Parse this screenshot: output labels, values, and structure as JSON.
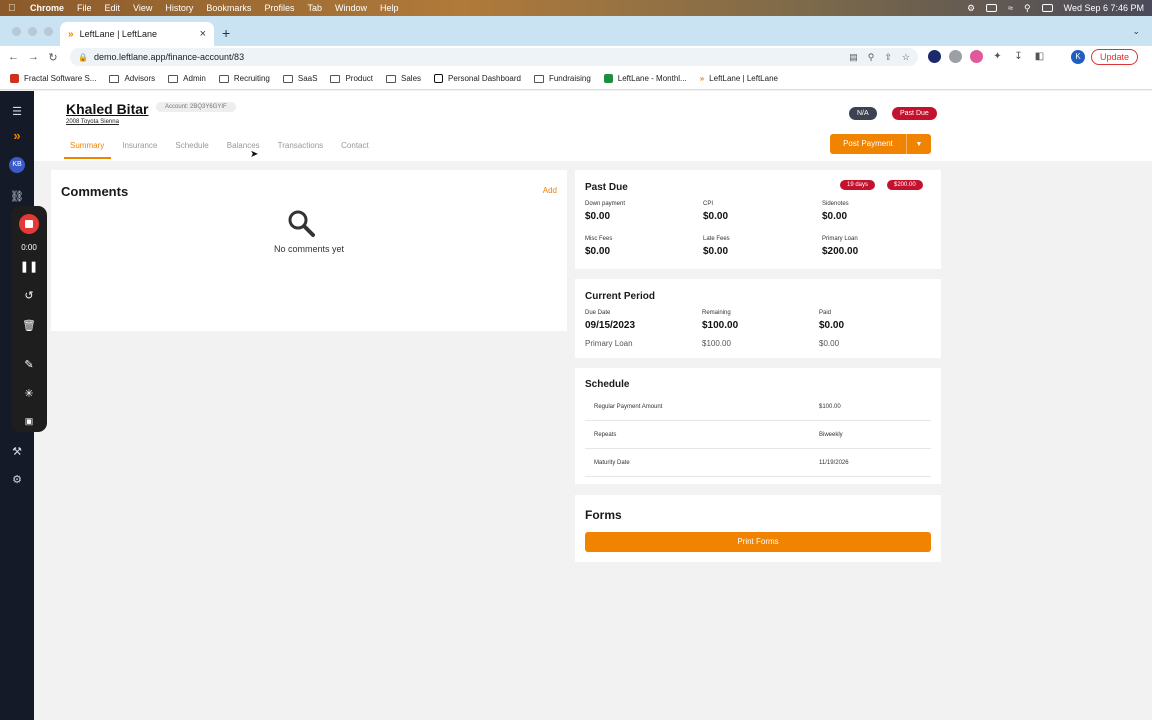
{
  "os_menubar": {
    "app_name": "Chrome",
    "menus": [
      "File",
      "Edit",
      "View",
      "History",
      "Bookmarks",
      "Profiles",
      "Tab",
      "Window",
      "Help"
    ],
    "clock": "Wed Sep 6  7:46 PM"
  },
  "browser": {
    "tab_title": "LeftLane | LeftLane",
    "url": "demo.leftlane.app/finance-account/83",
    "update_label": "Update",
    "profile_initial": "K",
    "bookmarks": [
      {
        "label": "Fractal Software S...",
        "icon": "fractal-icon"
      },
      {
        "label": "Advisors",
        "icon": "folder-icon"
      },
      {
        "label": "Admin",
        "icon": "folder-icon"
      },
      {
        "label": "Recruiting",
        "icon": "folder-icon"
      },
      {
        "label": "SaaS",
        "icon": "folder-icon"
      },
      {
        "label": "Product",
        "icon": "folder-icon"
      },
      {
        "label": "Sales",
        "icon": "folder-icon"
      },
      {
        "label": "Personal Dashboard",
        "icon": "notion-icon"
      },
      {
        "label": "Fundraising",
        "icon": "folder-icon"
      },
      {
        "label": "LeftLane - Monthl...",
        "icon": "sheets-icon"
      },
      {
        "label": "LeftLane | LeftLane",
        "icon": "leftlane-icon"
      }
    ]
  },
  "leftnav": {
    "user_initials": "KB"
  },
  "recorder": {
    "time": "0:00"
  },
  "account": {
    "name": "Khaled Bitar",
    "account_label": "Account: 2BQ3Y6GYIF",
    "vehicle": "2008 Toyota Sienna",
    "status_na": "N/A",
    "status_past_due": "Past Due",
    "post_payment_label": "Post Payment",
    "tabs": [
      "Summary",
      "Insurance",
      "Schedule",
      "Balances",
      "Transactions",
      "Contact"
    ],
    "active_tab": "Summary"
  },
  "comments": {
    "title": "Comments",
    "add_label": "Add",
    "empty_text": "No comments yet"
  },
  "past_due": {
    "title": "Past Due",
    "days_chip": "19 days",
    "amount_chip": "$200.00",
    "items": [
      {
        "label": "Down payment",
        "value": "$0.00"
      },
      {
        "label": "CPI",
        "value": "$0.00"
      },
      {
        "label": "Sidenotes",
        "value": "$0.00"
      },
      {
        "label": "Misc Fees",
        "value": "$0.00"
      },
      {
        "label": "Late Fees",
        "value": "$0.00"
      },
      {
        "label": "Primary Loan",
        "value": "$200.00"
      }
    ]
  },
  "current_period": {
    "title": "Current Period",
    "due_date_label": "Due Date",
    "due_date": "09/15/2023",
    "remaining_label": "Remaining",
    "remaining": "$100.00",
    "paid_label": "Paid",
    "paid": "$0.00",
    "line_label": "Primary Loan",
    "line_remaining": "$100.00",
    "line_paid": "$0.00"
  },
  "schedule": {
    "title": "Schedule",
    "rows": [
      {
        "key": "Regular Payment Amount",
        "value": "$100.00"
      },
      {
        "key": "Repeats",
        "value": "Biweekly"
      },
      {
        "key": "Maturity Date",
        "value": "11/19/2026"
      }
    ]
  },
  "forms": {
    "title": "Forms",
    "print_label": "Print Forms"
  },
  "colors": {
    "accent": "#f08300",
    "danger": "#c4122e",
    "nav_bg": "#141a28"
  }
}
